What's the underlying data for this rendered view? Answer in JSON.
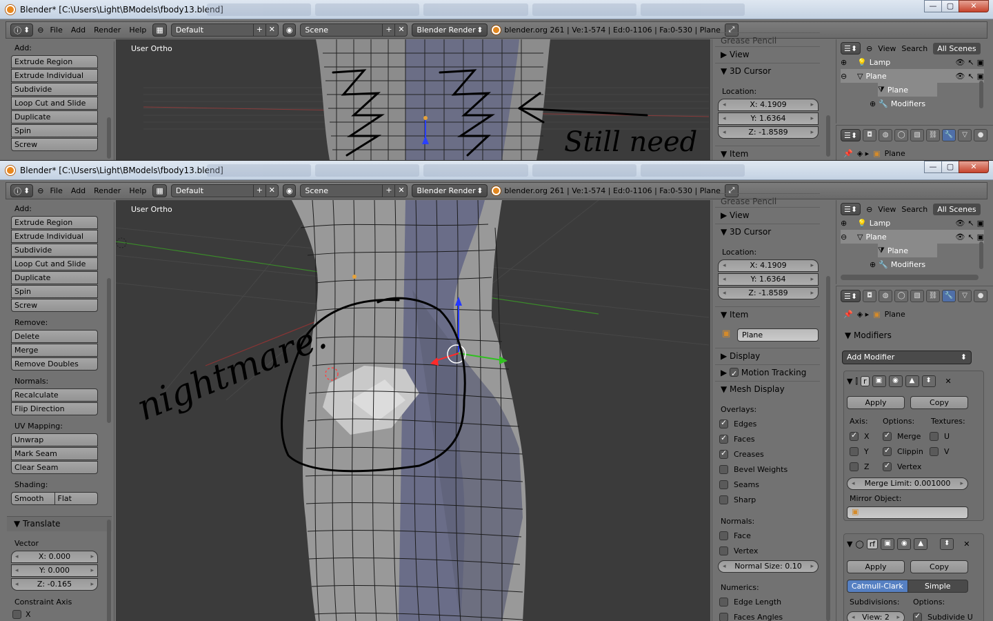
{
  "window": {
    "title": "Blender* [C:\\Users\\Light\\BModels\\fbody13.blend]",
    "controls": {
      "minimize": "—",
      "maximize": "▢",
      "close": "✕"
    }
  },
  "header": {
    "menus": [
      "File",
      "Add",
      "Render",
      "Help"
    ],
    "layout": "Default",
    "scene": "Scene",
    "renderer": "Blender Render",
    "stats": "blender.org 261 | Ve:1-574 | Ed:0-1106 | Fa:0-530 | Plane"
  },
  "viewport": {
    "label": "User Ortho"
  },
  "toolshelf": {
    "add_heading": "Add:",
    "add_buttons": [
      "Extrude Region",
      "Extrude Individual",
      "Subdivide",
      "Loop Cut and Slide",
      "Duplicate",
      "Spin",
      "Screw"
    ],
    "remove_heading": "Remove:",
    "remove_buttons": [
      "Delete",
      "Merge",
      "Remove Doubles"
    ],
    "normals_heading": "Normals:",
    "normals_buttons": [
      "Recalculate",
      "Flip Direction"
    ],
    "uv_heading": "UV Mapping:",
    "uv_buttons": [
      "Unwrap",
      "Mark Seam",
      "Clear Seam"
    ],
    "shading_heading": "Shading:",
    "shading_buttons": [
      "Smooth",
      "Flat"
    ],
    "operator": {
      "title": "Translate",
      "vector_label": "Vector",
      "x": "X: 0.000",
      "y": "Y: 0.000",
      "z": "Z: -0.165",
      "constraint_label": "Constraint Axis",
      "constraint_x": "X"
    }
  },
  "properties": {
    "grease_pencil": "Grease Pencil",
    "view": "View",
    "cursor": {
      "title": "3D Cursor",
      "location_label": "Location:",
      "x": "X: 4.1909",
      "y": "Y: 1.6364",
      "z": "Z: -1.8589"
    },
    "item": {
      "title": "Item",
      "name": "Plane"
    },
    "display": "Display",
    "motion_tracking": "Motion Tracking",
    "mesh_display": {
      "title": "Mesh Display",
      "overlays_label": "Overlays:",
      "overlays": [
        {
          "label": "Edges",
          "checked": true
        },
        {
          "label": "Faces",
          "checked": true
        },
        {
          "label": "Creases",
          "checked": true
        },
        {
          "label": "Bevel Weights",
          "checked": false
        },
        {
          "label": "Seams",
          "checked": false
        },
        {
          "label": "Sharp",
          "checked": false
        }
      ],
      "normals_label": "Normals:",
      "normals": [
        {
          "label": "Face",
          "checked": false
        },
        {
          "label": "Vertex",
          "checked": false
        }
      ],
      "normal_size": "Normal Size: 0.10",
      "numerics_label": "Numerics:",
      "numerics": [
        {
          "label": "Edge Length",
          "checked": false
        },
        {
          "label": "Faces Angles",
          "checked": false
        }
      ]
    }
  },
  "outliner": {
    "menus": [
      "View",
      "Search"
    ],
    "scope": "All Scenes",
    "rows": [
      "Lamp",
      "Plane",
      "Plane",
      "Modifiers"
    ]
  },
  "modifiers": {
    "context_object": "Plane",
    "title": "Modifiers",
    "add_modifier": "Add Modifier",
    "mirror": {
      "name": "r",
      "apply": "Apply",
      "copy": "Copy",
      "axis_label": "Axis:",
      "options_label": "Options:",
      "textures_label": "Textures:",
      "axes": [
        {
          "label": "X",
          "checked": true
        },
        {
          "label": "Y",
          "checked": false
        },
        {
          "label": "Z",
          "checked": false
        }
      ],
      "options": [
        {
          "label": "Merge",
          "checked": true
        },
        {
          "label": "Clippin",
          "checked": true
        },
        {
          "label": "Vertex",
          "checked": true
        }
      ],
      "textures": [
        {
          "label": "U",
          "checked": false
        },
        {
          "label": "V",
          "checked": false
        }
      ],
      "merge_limit": "Merge Limit: 0.001000",
      "mirror_object_label": "Mirror Object:"
    },
    "subsurf": {
      "name": "rf",
      "apply": "Apply",
      "copy": "Copy",
      "mode_a": "Catmull-Clark",
      "mode_b": "Simple",
      "subdivisions_label": "Subdivisions:",
      "options_label": "Options:",
      "view": "View: 2",
      "subdivide_uv": "Subdivide U"
    }
  },
  "annotations": {
    "top": "Still need",
    "bottom": "nightmare."
  },
  "colors": {
    "panel": "#727272",
    "viewport": "#3b3b3b",
    "accent": "#5680c2",
    "mesh": "#9c9c9c"
  }
}
